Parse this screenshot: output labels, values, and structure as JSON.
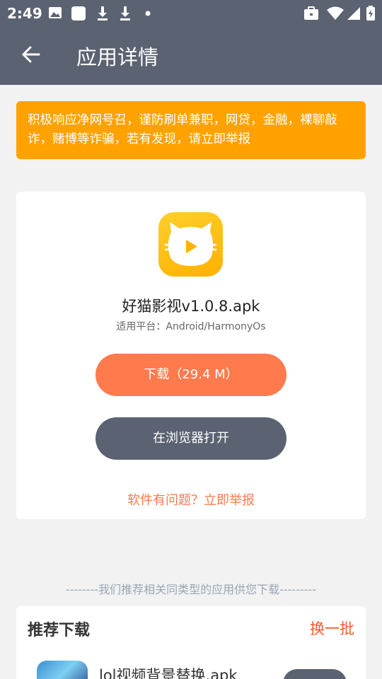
{
  "status_bar": {
    "time": "2:49",
    "left_icons": [
      "image-icon",
      "square-app-icon",
      "download-icon",
      "download-icon",
      "dot-icon"
    ],
    "right_icons": [
      "briefcase-icon",
      "wifi-icon",
      "signal-icon",
      "battery-icon"
    ]
  },
  "app_bar": {
    "title": "应用详情"
  },
  "warning": {
    "text": "积极响应净网号召，谨防刷单兼职，网贷，金融，裸聊敲诈，赌博等诈骗，若有发现，请立即举报"
  },
  "app": {
    "name": "好猫影视v1.0.8.apk",
    "platform": "适用平台：Android/HarmonyOs",
    "download_label": "下载（29.4 M）",
    "browser_label": "在浏览器打开",
    "report_label": "软件有问题？立即举报"
  },
  "recommend": {
    "hint": "--------我们推荐相关同类型的应用供您下载---------",
    "title": "推荐下载",
    "refresh_label": "换一批",
    "items": [
      {
        "name": "lol视频背景替换.apk"
      }
    ]
  },
  "colors": {
    "bar": "#5b6271",
    "warning": "#ffa200",
    "accent": "#ff7a4d",
    "refresh": "#ff5a2a"
  }
}
